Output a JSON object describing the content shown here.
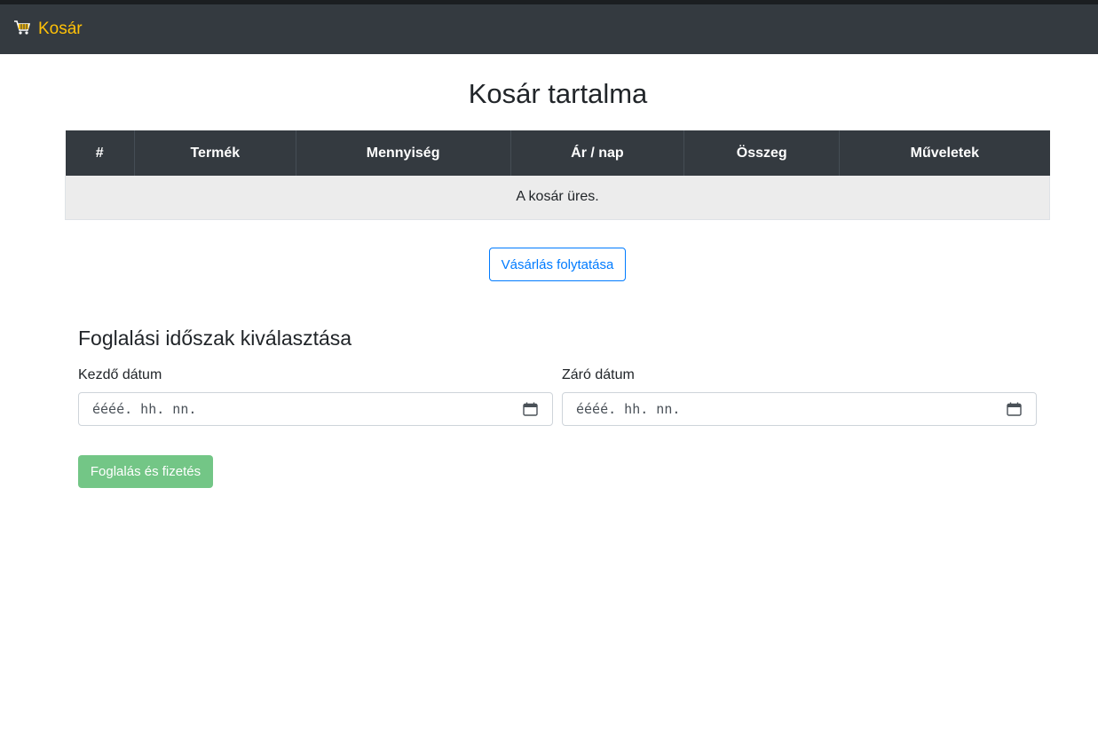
{
  "navbar": {
    "brand_icon": "shopping-cart-icon",
    "brand_label": "Kosár",
    "brand_color": "#ffc107",
    "background": "#343a40"
  },
  "page": {
    "title": "Kosár tartalma"
  },
  "cart_table": {
    "headers": [
      "#",
      "Termék",
      "Mennyiség",
      "Ár / nap",
      "Összeg",
      "Műveletek"
    ],
    "empty_message": "A kosár üres."
  },
  "continue_button": {
    "label": "Vásárlás folytatása",
    "color": "#007bff"
  },
  "booking": {
    "title": "Foglalási időszak kiválasztása",
    "start_label": "Kezdő dátum",
    "start_placeholder": "éééé. hh. nn.",
    "end_label": "Záró dátum",
    "end_placeholder": "éééé. hh. nn.",
    "submit_label": "Foglalás és fizetés",
    "submit_color": "#73c686",
    "submit_disabled": true
  }
}
